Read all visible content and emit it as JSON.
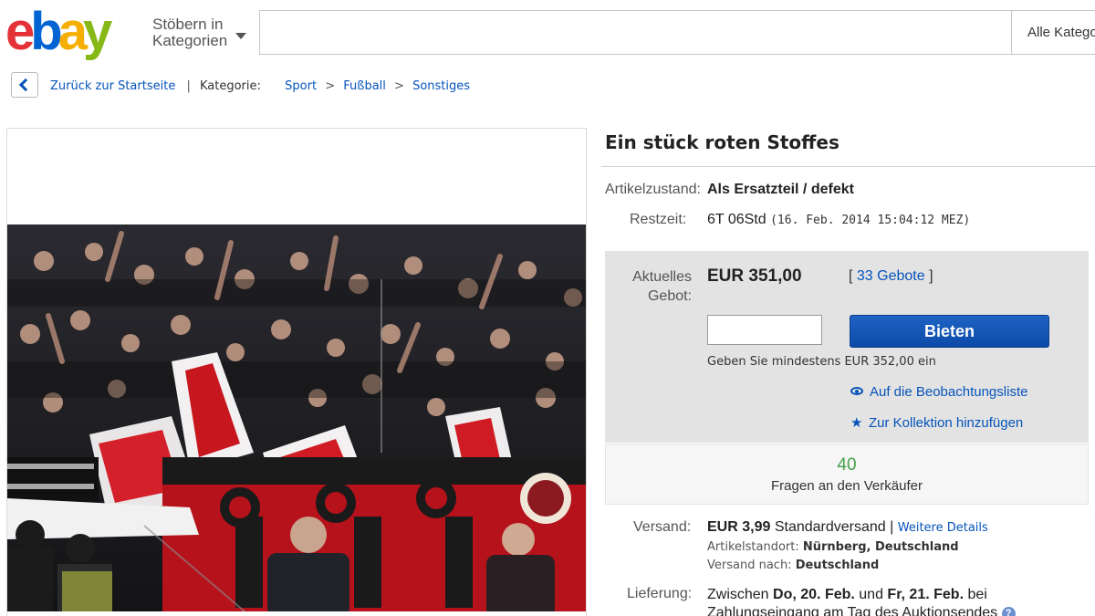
{
  "header": {
    "logo_letters": [
      "e",
      "b",
      "a",
      "y"
    ],
    "browse_line1": "Stöbern in",
    "browse_line2": "Kategorien",
    "search_placeholder": "",
    "category_select": "Alle Kategorien"
  },
  "breadcrumb": {
    "back_link": "Zurück zur Startseite",
    "separator": "|",
    "category_label": "Kategorie:",
    "items": [
      "Sport",
      "Fußball",
      "Sonstiges"
    ],
    "arrow": ">"
  },
  "item": {
    "title": "Ein stück roten Stoffes",
    "condition_label": "Artikelzustand:",
    "condition_value": "Als Ersatzteil / defekt",
    "time_label": "Restzeit:",
    "time_value": "6T 06Std",
    "time_detail": "(16. Feb. 2014  15:04:12 MEZ)"
  },
  "bid": {
    "label_line1": "Aktuelles",
    "label_line2": "Gebot:",
    "price": "EUR 351,00",
    "count_open": "[",
    "count_link": "33 Gebote",
    "count_close": "]",
    "input_value": "",
    "button_label": "Bieten",
    "min_text": "Geben Sie mindestens EUR 352,00 ein",
    "watch_label": "Auf die Beobachtungsliste",
    "collection_label": "Zur Kollektion hinzufügen"
  },
  "questions": {
    "count": "40",
    "label": "Fragen an den Verkäufer"
  },
  "shipping": {
    "label": "Versand:",
    "price": "EUR 3,99",
    "method": "Standardversand |",
    "details_link": "Weitere Details",
    "location_label": "Artikelstandort:",
    "location_value": "Nürnberg, Deutschland",
    "to_label": "Versand nach:",
    "to_value": "Deutschland"
  },
  "delivery": {
    "label": "Lieferung:",
    "text_prefix": "Zwischen ",
    "date_from": "Do, 20. Feb.",
    "text_and": " und ",
    "date_to": "Fr, 21. Feb.",
    "text_suffix": " bei Zahlungseingang am Tag des Auktionsendes",
    "help_icon": "?"
  },
  "colors": {
    "ebay_red": "#e53238",
    "ebay_blue": "#0064d2",
    "ebay_yellow": "#f5af02",
    "ebay_green": "#86b817",
    "link_blue": "#0654ba",
    "bid_box_bg": "#e3e3e3"
  }
}
